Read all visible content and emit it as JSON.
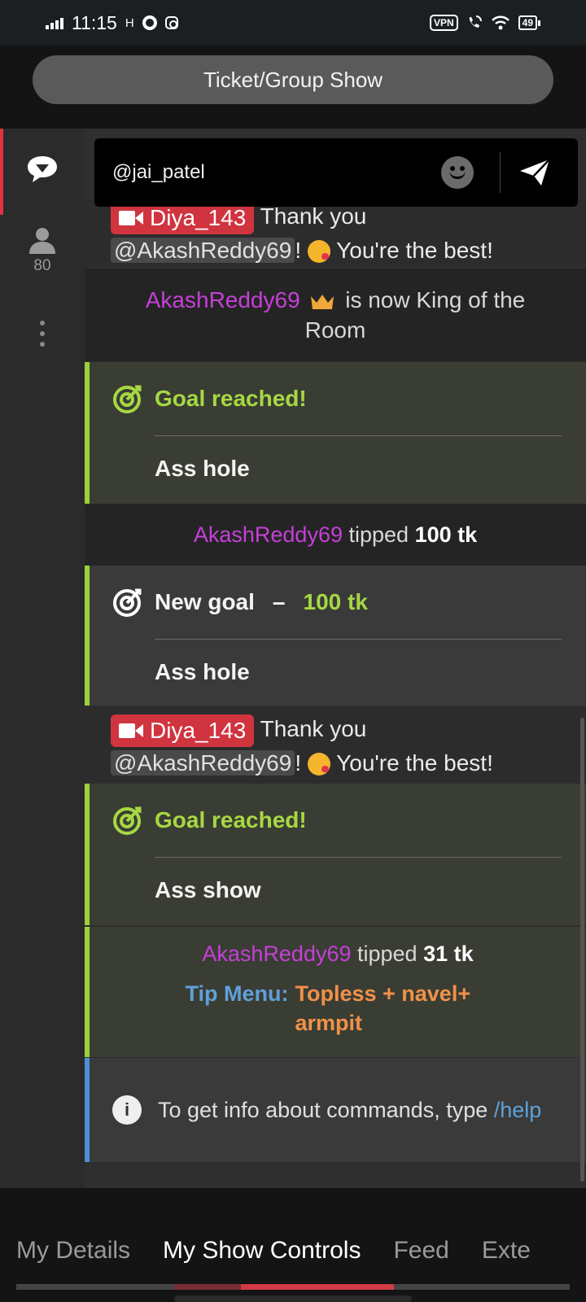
{
  "status_bar": {
    "time": "11:15",
    "h_indicator": "H",
    "vpn": "VPN",
    "battery": "49"
  },
  "header": {
    "ticket_button": "Ticket/Group Show"
  },
  "rail": {
    "users_count": "80"
  },
  "input": {
    "value": "@jai_patel"
  },
  "chat": {
    "dm_top": {
      "user": "Diya_143",
      "text": "Thank you",
      "mention": "@AkashReddy69",
      "after": "! ",
      "tail": " You're the best!"
    },
    "king": {
      "user": "AkashReddy69",
      "line1": " is now King of the",
      "line2": "Room"
    },
    "goal1": {
      "title": "Goal reached!",
      "sub": "Ass hole"
    },
    "tip1": {
      "user": "AkashReddy69",
      "text": " tipped ",
      "amount": "100 tk"
    },
    "goal2": {
      "title": "New goal",
      "dash": "–",
      "amount": "100 tk",
      "sub": "Ass hole"
    },
    "dm2": {
      "user": "Diya_143",
      "text": "Thank you",
      "mention": "@AkashReddy69",
      "after": "! ",
      "tail": " You're the best!"
    },
    "goal3": {
      "title": "Goal reached!",
      "sub": "Ass show"
    },
    "tip2": {
      "user": "AkashReddy69",
      "text": " tipped ",
      "amount": "31 tk",
      "menu_label": "Tip Menu:",
      "menu_item": "Topless + navel+ armpit"
    },
    "info": {
      "text": "To get info about commands, type ",
      "cmd": "/help"
    }
  },
  "tabs": [
    "My Details",
    "My Show Controls",
    "Feed",
    "Exte"
  ],
  "colors": {
    "accent_red": "#d0343f",
    "goal_green": "#a6d843",
    "username_purple": "#c540d8",
    "tipmenu_blue": "#5fa0d8",
    "tipmenu_orange": "#f0914a",
    "info_blue": "#4a8fd8"
  }
}
